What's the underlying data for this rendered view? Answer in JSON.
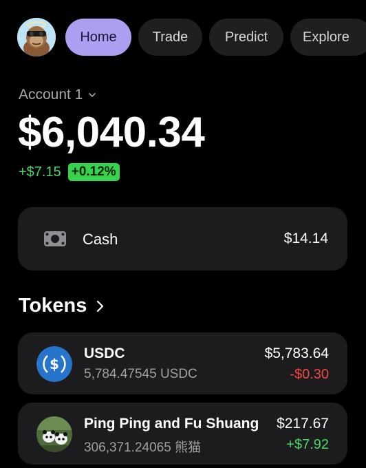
{
  "nav": {
    "avatar_icon": "ape-avatar-icon",
    "tabs": [
      {
        "label": "Home",
        "active": true
      },
      {
        "label": "Trade",
        "active": false
      },
      {
        "label": "Predict",
        "active": false
      },
      {
        "label": "Explore",
        "active": false
      }
    ]
  },
  "account": {
    "name": "Account 1",
    "balance": "$6,040.34",
    "change_amount": "+$7.15",
    "change_percent": "+0.12%"
  },
  "cash": {
    "icon": "cash-icon",
    "label": "Cash",
    "value": "$14.14"
  },
  "tokens": {
    "title": "Tokens",
    "items": [
      {
        "name": "USDC",
        "amount": "5,784.47545 USDC",
        "value": "$5,783.64",
        "change": "-$0.30",
        "change_direction": "negative",
        "icon": "usdc-icon"
      },
      {
        "name": "Ping Ping and Fu Shuang",
        "amount": "306,371.24065 熊猫",
        "value": "$217.67",
        "change": "+$7.92",
        "change_direction": "positive",
        "icon": "panda-token-icon"
      }
    ]
  },
  "colors": {
    "background": "#000000",
    "card": "#1c1c1e",
    "accent": "#ab9ff2",
    "positive": "#4cd964",
    "negative": "#f0473f",
    "usdc_blue": "#2775ca"
  }
}
